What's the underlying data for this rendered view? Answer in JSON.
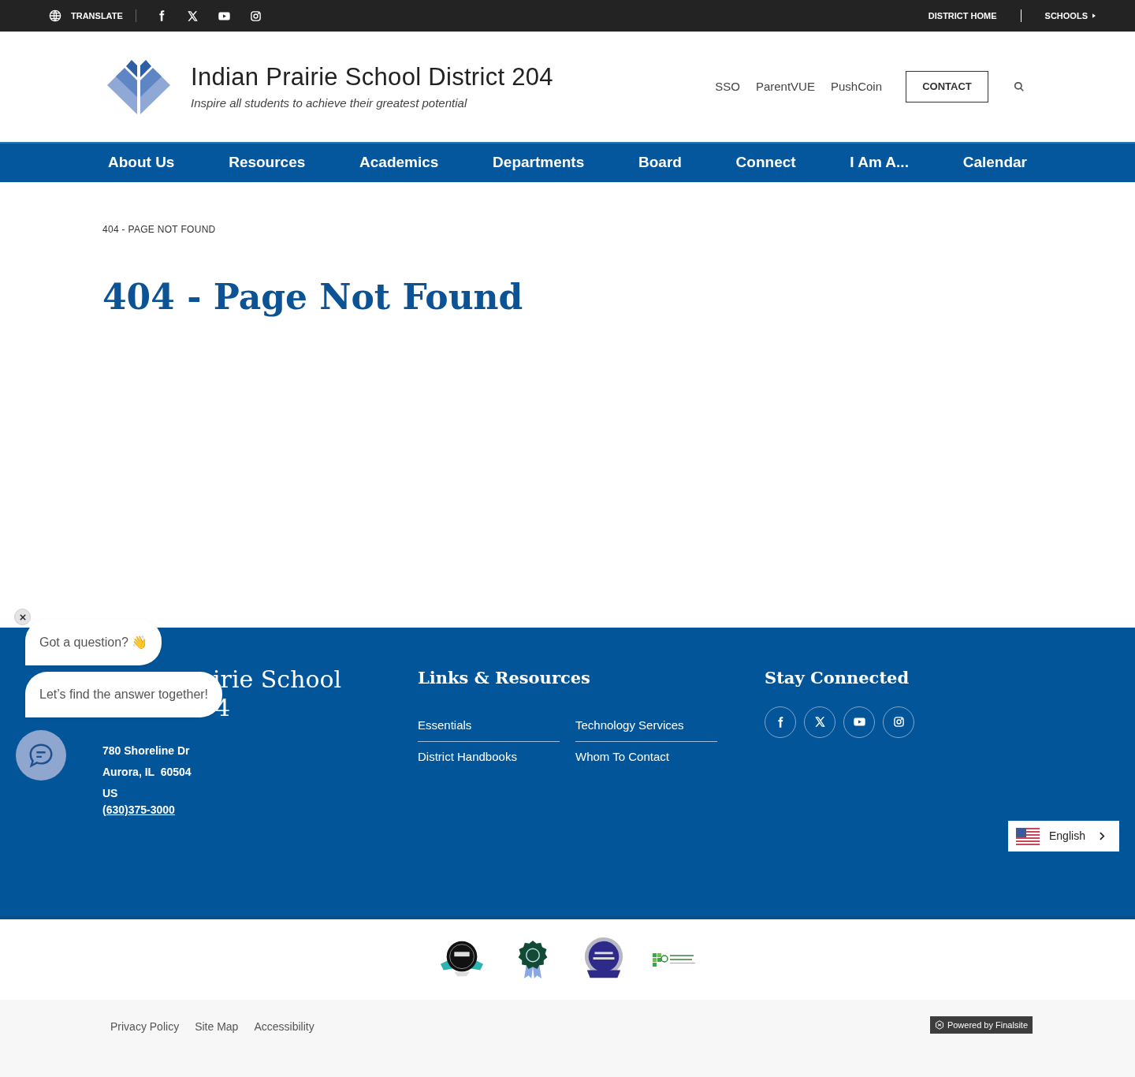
{
  "top_bar": {
    "translate": "TRANSLATE",
    "links": [
      "DISTRICT HOME",
      "SCHOOLS"
    ]
  },
  "header": {
    "title": "Indian Prairie School District 204",
    "tagline": "Inspire all students to achieve their greatest potential",
    "links": [
      "SSO",
      "ParentVUE",
      "PushCoin"
    ],
    "contact": "CONTACT"
  },
  "nav": {
    "items": [
      "About Us",
      "Resources",
      "Academics",
      "Departments",
      "Board",
      "Connect",
      "I Am A...",
      "Calendar"
    ]
  },
  "breadcrumb": "404 - PAGE NOT FOUND",
  "page_title": "404 - Page Not Found",
  "footer": {
    "title_visible_parts": [
      "irie School",
      "4"
    ],
    "address": [
      "780 Shoreline Dr",
      "Aurora, IL  60504",
      "US"
    ],
    "phone": "(630)375-3000",
    "links_heading": "Links & Resources",
    "links": [
      "Essentials",
      "Technology Services",
      "District Handbooks",
      "Whom To Contact"
    ],
    "connect_heading": "Stay Connected",
    "language": "English"
  },
  "chat": {
    "bubbles": [
      "Got a question? 👋",
      "Let’s find the answer together!"
    ]
  },
  "bottom": {
    "links": [
      "Privacy Policy",
      "Site Map",
      "Accessibility"
    ],
    "powered": "Powered by Finalsite"
  }
}
